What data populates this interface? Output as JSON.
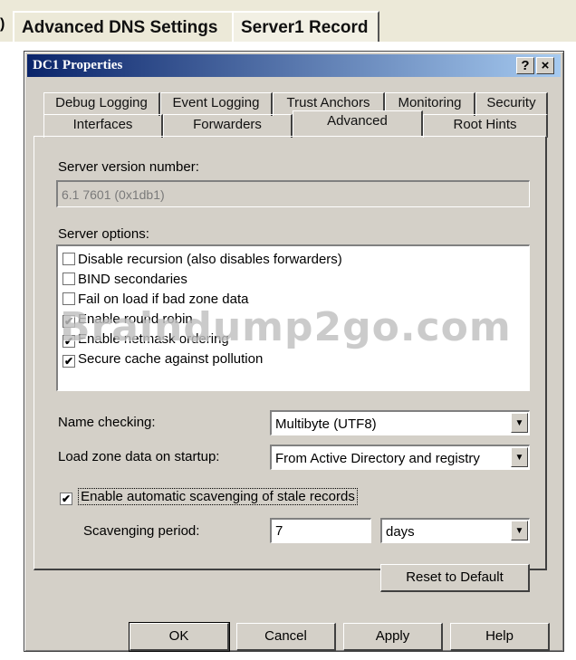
{
  "outer_tabs": [
    "Advanced DNS Settings",
    "Server1 Record"
  ],
  "dialog": {
    "title": "DC1 Properties",
    "help_button": "?",
    "close_button": "×"
  },
  "tabs_row1": [
    "Debug Logging",
    "Event Logging",
    "Trust Anchors",
    "Monitoring",
    "Security"
  ],
  "tabs_row2": [
    "Interfaces",
    "Forwarders",
    "Advanced",
    "Root Hints"
  ],
  "active_tab": "Advanced",
  "server_version": {
    "label": "Server version number:",
    "value": "6.1 7601 (0x1db1)"
  },
  "server_options": {
    "label": "Server options:",
    "items": [
      {
        "label": "Disable recursion (also disables forwarders)",
        "checked": false
      },
      {
        "label": "BIND secondaries",
        "checked": false
      },
      {
        "label": "Fail on load if bad zone data",
        "checked": false
      },
      {
        "label": "Enable round robin",
        "checked": true
      },
      {
        "label": "Enable netmask ordering",
        "checked": true
      },
      {
        "label": "Secure cache against pollution",
        "checked": true
      }
    ]
  },
  "watermark": "Braindump2go.com",
  "name_checking": {
    "label": "Name checking:",
    "value": "Multibyte (UTF8)"
  },
  "load_zone": {
    "label": "Load zone data on startup:",
    "value": "From Active Directory and registry"
  },
  "scavenging": {
    "checkbox_label": "Enable automatic scavenging of stale records",
    "checked": true,
    "period_label": "Scavenging period:",
    "period_value": "7",
    "period_unit": "days"
  },
  "reset_button": "Reset to Default",
  "footer_buttons": {
    "ok": "OK",
    "cancel": "Cancel",
    "apply": "Apply",
    "help": "Help"
  },
  "check_mark": "✔",
  "dropdown_glyph": "▼"
}
